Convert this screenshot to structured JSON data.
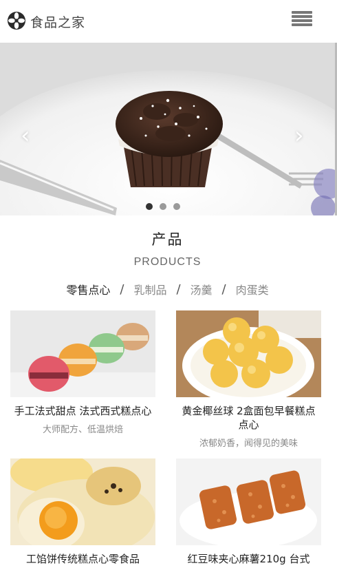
{
  "header": {
    "brand": "食品之家",
    "logo_icon": "flower-logo-icon",
    "menu_icon": "hamburger-menu-icon"
  },
  "banner": {
    "prev_arrow": "‹",
    "next_arrow": "›",
    "slides": 3,
    "active_slide": 1
  },
  "section": {
    "title": "产品",
    "subtitle": "PRODUCTS"
  },
  "tabs": [
    {
      "label": "零售点心",
      "active": true
    },
    {
      "label": "乳制品",
      "active": false
    },
    {
      "label": "汤羹",
      "active": false
    },
    {
      "label": "肉蛋类",
      "active": false
    }
  ],
  "tab_separator": "/",
  "products": [
    {
      "name": "手工法式甜点 法式西式糕点心",
      "desc": "大师配方、低温烘焙"
    },
    {
      "name": "黄金椰丝球 2盒面包早餐糕点点心",
      "desc": "浓郁奶香，闻得见的美味"
    },
    {
      "name": "工馅饼传统糕点心零食品",
      "desc": ""
    },
    {
      "name": "红豆味夹心麻薯210g 台式",
      "desc": ""
    }
  ],
  "colors": {
    "text_dark": "#222222",
    "text_muted": "#888888",
    "dot_active": "#333333",
    "dot_inactive": "#9a9a9a"
  }
}
